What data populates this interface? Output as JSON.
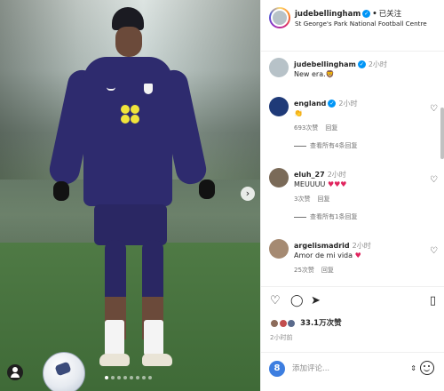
{
  "post": {
    "username": "judebellingham",
    "separator": "•",
    "follow_state": "已关注",
    "location": "St George's Park National Football Centre"
  },
  "comments": [
    {
      "user": "judebellingham",
      "verified": true,
      "time": "2小时",
      "text": "New era.🦁"
    },
    {
      "user": "england",
      "verified": true,
      "time": "2小时",
      "text": "👏",
      "likes": "693次赞",
      "reply": "回复",
      "view_replies": "查看所有4条回复"
    },
    {
      "user": "eluh_27",
      "verified": false,
      "time": "2小时",
      "text": "MEUUUU",
      "hearts": "♥♥♥",
      "likes": "3次赞",
      "reply": "回复",
      "view_replies": "查看所有1条回复"
    },
    {
      "user": "argelismadrid",
      "verified": false,
      "time": "2小时",
      "text": "Amor de mi vida",
      "hearts": "♥",
      "likes": "25次赞",
      "reply": "回复"
    }
  ],
  "actions": {
    "likes_count": "33.1万次赞",
    "posted_time": "2小时前"
  },
  "composer": {
    "avatar_letter": "8",
    "placeholder": "添加评论..."
  },
  "icons": {
    "like": "heart-outline",
    "comment": "speech-bubble",
    "share": "paper-plane",
    "save": "bookmark",
    "next": "chevron-right",
    "emoji": "smiley"
  },
  "colors": {
    "verified": "#0095f6",
    "kit": "#2e2b6e",
    "sponsor": "#f0e43b",
    "heart_red": "#e0245e"
  },
  "carousel": {
    "count": 8,
    "active_index": 0
  }
}
